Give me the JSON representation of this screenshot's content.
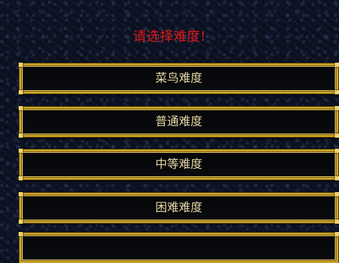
{
  "screen": {
    "prompt": "请选择难度!"
  },
  "menu": {
    "items": [
      {
        "label": "菜鸟难度"
      },
      {
        "label": "普通难度"
      },
      {
        "label": "中等难度"
      },
      {
        "label": "困难难度"
      },
      {
        "label": ""
      }
    ]
  },
  "colors": {
    "prompt": "#e01b1b",
    "button_border": "#c9a227",
    "button_text": "#e6d9a8",
    "background": "#0a0f1c"
  }
}
